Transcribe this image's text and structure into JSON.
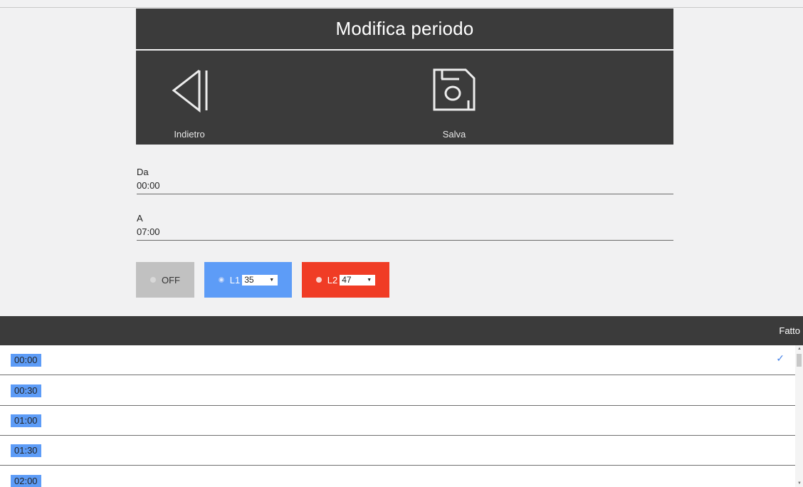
{
  "header": {
    "title": "Modifica periodo"
  },
  "actions": {
    "back_label": "Indietro",
    "save_label": "Salva"
  },
  "form": {
    "from": {
      "label": "Da",
      "value": "00:00"
    },
    "to": {
      "label": "A",
      "value": "07:00"
    }
  },
  "levels": {
    "off": {
      "label": "OFF"
    },
    "l1": {
      "label": "L1",
      "value": "35"
    },
    "l2": {
      "label": "L2",
      "value": "47"
    }
  },
  "picker": {
    "done_label": "Fatto",
    "selected_check": "✓",
    "times": [
      "00:00",
      "00:30",
      "01:00",
      "01:30",
      "02:00"
    ]
  },
  "colors": {
    "dark": "#3b3b3b",
    "l1": "#5d9cf7",
    "l2": "#f03c25",
    "off": "#c1c1c1"
  }
}
